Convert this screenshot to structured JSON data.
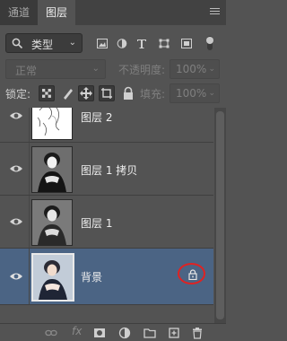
{
  "tabs": {
    "channels": "通道",
    "layers": "图层"
  },
  "filter": {
    "label": "类型"
  },
  "blend_mode": "正常",
  "opacity": {
    "label": "不透明度:",
    "value": "100%"
  },
  "lock": {
    "label": "锁定:"
  },
  "fill": {
    "label": "填充:",
    "value": "100%"
  },
  "layers": [
    {
      "name": "图层 2"
    },
    {
      "name": "图层 1 拷贝"
    },
    {
      "name": "图层 1"
    },
    {
      "name": "背景"
    }
  ],
  "bottom_bar": {
    "fx_label": "fx"
  },
  "colors": {
    "panel": "#535353",
    "selected_row": "#4b6484",
    "annotation": "#e02222"
  }
}
